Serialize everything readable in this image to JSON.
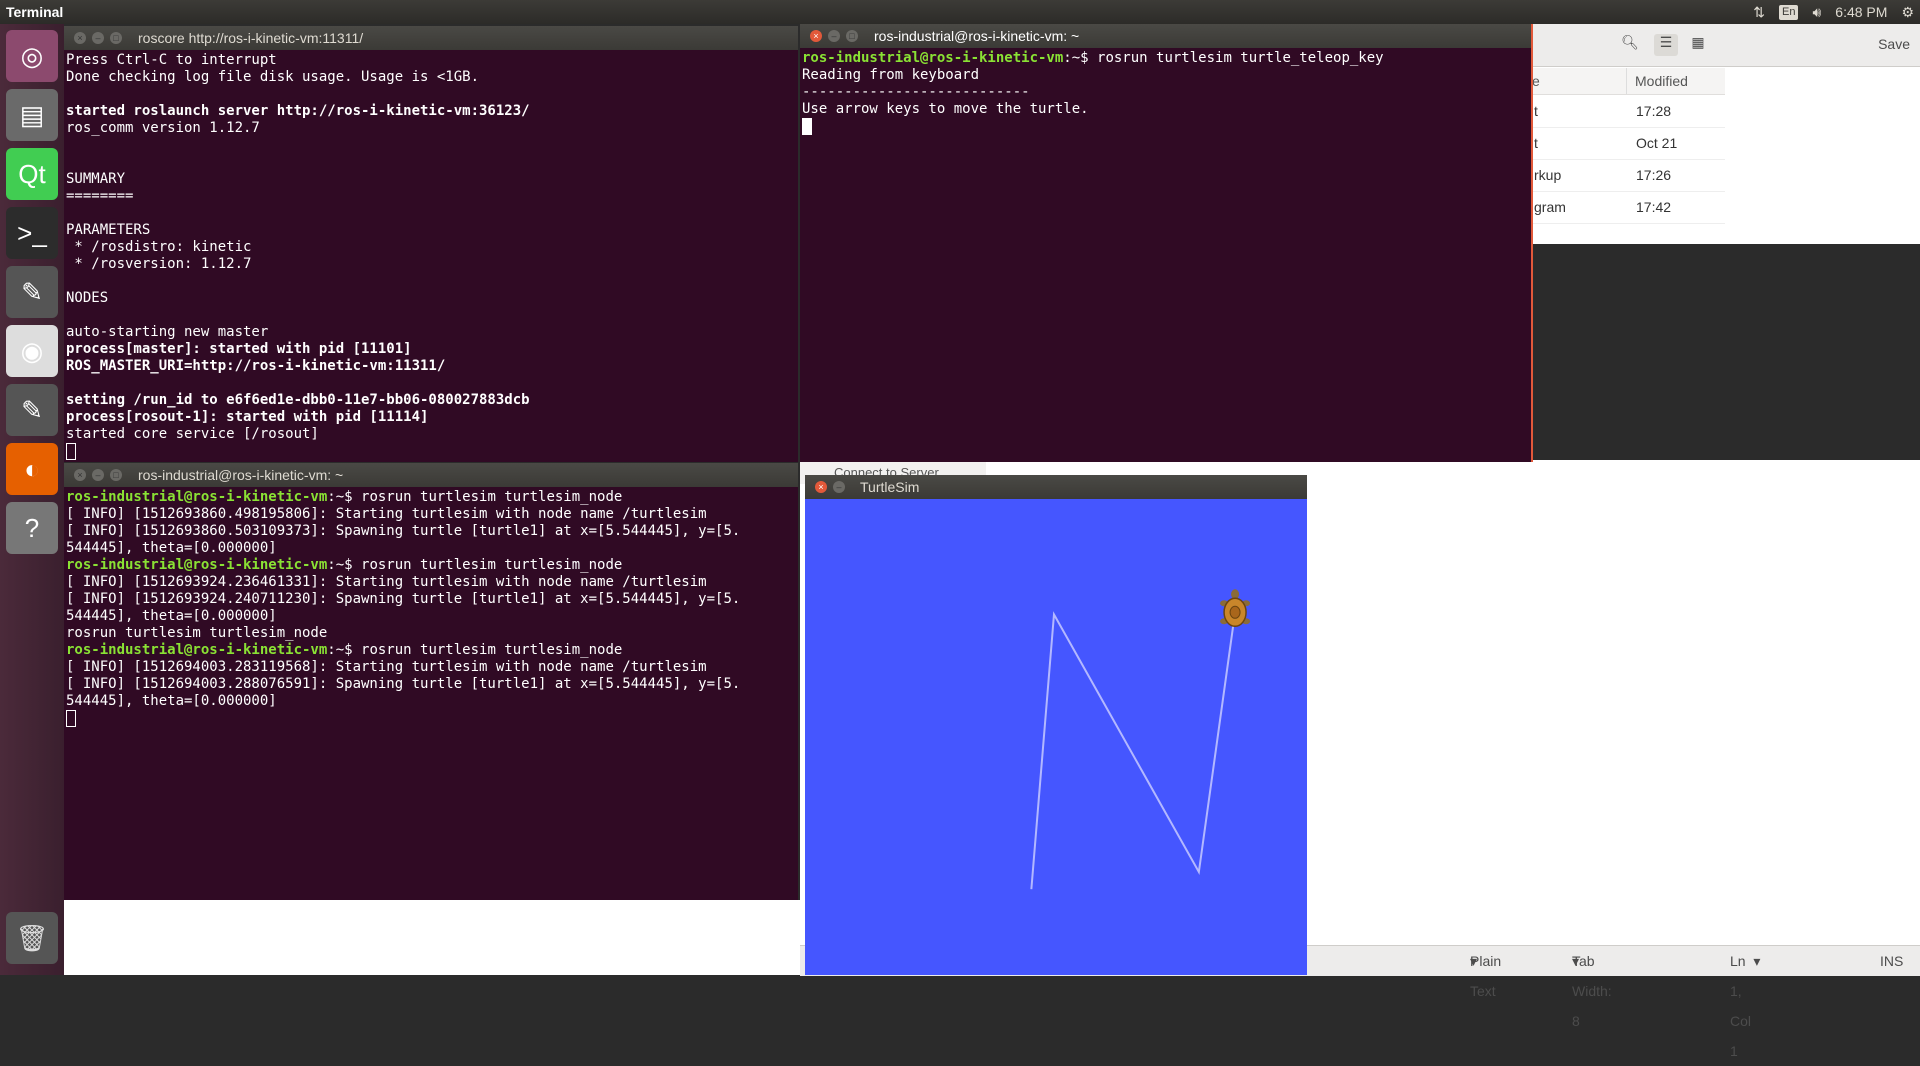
{
  "topbar": {
    "app_name": "Terminal",
    "keyboard_layout": "En",
    "time": "6:48 PM"
  },
  "launcher": {
    "items": [
      {
        "name": "ubuntu-dash-icon",
        "glyph": "◎"
      },
      {
        "name": "files-icon",
        "glyph": "▤"
      },
      {
        "name": "qt-creator-icon",
        "glyph": "Qt"
      },
      {
        "name": "terminal-icon",
        "glyph": ">_"
      },
      {
        "name": "text-editor-icon",
        "glyph": "✎"
      },
      {
        "name": "chrome-icon",
        "glyph": "◉"
      },
      {
        "name": "text-editor-2-icon",
        "glyph": "✎"
      },
      {
        "name": "firefox-icon",
        "glyph": "◐"
      },
      {
        "name": "unknown-app-icon",
        "glyph": "?"
      }
    ],
    "trash_glyph": "🗑"
  },
  "roscore": {
    "title": "roscore http://ros-i-kinetic-vm:11311/",
    "lines": [
      {
        "t": "Press Ctrl-C to interrupt",
        "b": false
      },
      {
        "t": "Done checking log file disk usage. Usage is <1GB.",
        "b": false
      },
      {
        "t": "",
        "b": false
      },
      {
        "t": "started roslaunch server http://ros-i-kinetic-vm:36123/",
        "b": true
      },
      {
        "t": "ros_comm version 1.12.7",
        "b": false
      },
      {
        "t": "",
        "b": false
      },
      {
        "t": "",
        "b": false
      },
      {
        "t": "SUMMARY",
        "b": false
      },
      {
        "t": "========",
        "b": false
      },
      {
        "t": "",
        "b": false
      },
      {
        "t": "PARAMETERS",
        "b": false
      },
      {
        "t": " * /rosdistro: kinetic",
        "b": false
      },
      {
        "t": " * /rosversion: 1.12.7",
        "b": false
      },
      {
        "t": "",
        "b": false
      },
      {
        "t": "NODES",
        "b": false
      },
      {
        "t": "",
        "b": false
      },
      {
        "t": "auto-starting new master",
        "b": false
      },
      {
        "t": "process[master]: started with pid [11101]",
        "b": true
      },
      {
        "t": "ROS_MASTER_URI=http://ros-i-kinetic-vm:11311/",
        "b": true
      },
      {
        "t": "",
        "b": false
      },
      {
        "t": "setting /run_id to e6f6ed1e-dbb0-11e7-bb06-080027883dcb",
        "b": true
      },
      {
        "t": "process[rosout-1]: started with pid [11114]",
        "b": true
      },
      {
        "t": "started core service [/rosout]",
        "b": false
      }
    ]
  },
  "teleop": {
    "title": "ros-industrial@ros-i-kinetic-vm: ~",
    "prompt": "ros-industrial@ros-i-kinetic-vm",
    "prompt_suffix": ":~$ ",
    "command": "rosrun turtlesim turtle_teleop_key",
    "lines": [
      "Reading from keyboard",
      "---------------------------",
      "Use arrow keys to move the turtle."
    ]
  },
  "turtlesim_term": {
    "title": "ros-industrial@ros-i-kinetic-vm: ~",
    "prompt": "ros-industrial@ros-i-kinetic-vm",
    "prompt_suffix": ":~$ ",
    "blocks": [
      {
        "command": "rosrun turtlesim turtlesim_node",
        "output": [
          "[ INFO] [1512693860.498195806]: Starting turtlesim with node name /turtlesim",
          "[ INFO] [1512693860.503109373]: Spawning turtle [turtle1] at x=[5.544445], y=[5.",
          "544445], theta=[0.000000]"
        ]
      },
      {
        "command": "rosrun turtlesim turtlesim_node",
        "output": [
          "[ INFO] [1512693924.236461331]: Starting turtlesim with node name /turtlesim",
          "[ INFO] [1512693924.240711230]: Spawning turtle [turtle1] at x=[5.544445], y=[5.",
          "544445], theta=[0.000000]",
          "rosrun turtlesim turtlesim_node"
        ]
      },
      {
        "command": "rosrun turtlesim turtlesim_node",
        "output": [
          "[ INFO] [1512694003.283119568]: Starting turtlesim with node name /turtlesim",
          "[ INFO] [1512694003.288076591]: Spawning turtle [turtle1] at x=[5.544445], y=[5.",
          "544445], theta=[0.000000]"
        ]
      }
    ]
  },
  "turtlesim_window": {
    "title": "TurtleSim",
    "background": "#4556ff",
    "pen_color": "#b3b8ff",
    "path": [
      [
        5.0,
        2.0
      ],
      [
        5.5,
        8.4
      ],
      [
        8.7,
        2.4
      ],
      [
        9.5,
        8.45
      ]
    ]
  },
  "files": {
    "column_partial": "e",
    "column_modified": "Modified",
    "rows": [
      {
        "name": "t",
        "modified": "17:28"
      },
      {
        "name": "t",
        "modified": "Oct 21"
      },
      {
        "name": "rkup",
        "modified": "17:26"
      },
      {
        "name": "gram",
        "modified": "17:42"
      }
    ],
    "save_label": "Save"
  },
  "behind": {
    "connect_label": "Connect to Server"
  },
  "editor_status": {
    "language": "Plain Text",
    "tab_width": "Tab Width: 8",
    "position": "Ln 1, Col 1",
    "mode": "INS"
  }
}
